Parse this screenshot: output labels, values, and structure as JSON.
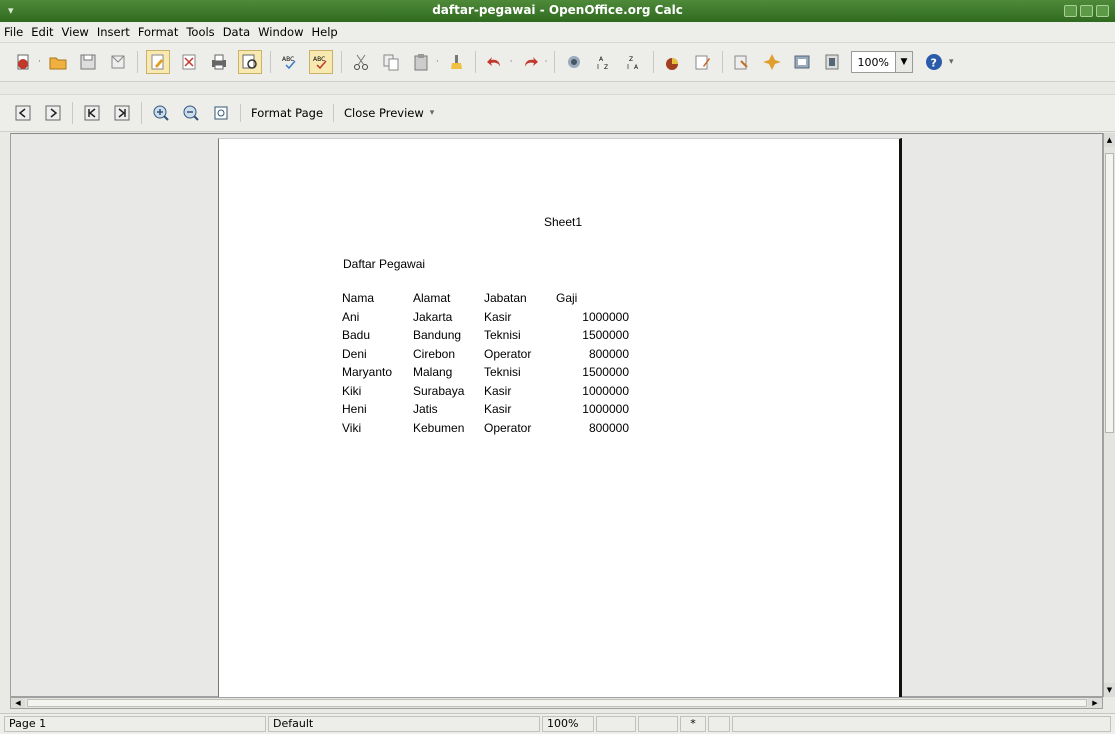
{
  "window": {
    "title": "daftar-pegawai - OpenOffice.org Calc"
  },
  "menu": [
    "File",
    "Edit",
    "View",
    "Insert",
    "Format",
    "Tools",
    "Data",
    "Window",
    "Help"
  ],
  "toolbar": {
    "icons": [
      "new-icon",
      "open-icon",
      "save-icon",
      "email-icon",
      "edit-file-icon",
      "export-pdf-icon",
      "print-icon",
      "page-preview-icon",
      "spellcheck-icon",
      "autospellcheck-icon",
      "cut-icon",
      "copy-icon",
      "paste-icon",
      "clone-format-icon",
      "undo-icon",
      "redo-icon",
      "hyperlink-icon",
      "sort-ascending-icon",
      "sort-descending-icon",
      "chart-icon",
      "draw-functions-icon",
      "navigator-icon",
      "gallery-icon",
      "datasource-icon",
      "help-icon"
    ],
    "zoom_value": "100%"
  },
  "preview_toolbar": {
    "format_page": "Format Page",
    "close_preview": "Close Preview"
  },
  "page": {
    "sheet_name": "Sheet1",
    "title": "Daftar Pegawai",
    "headers": [
      "Nama",
      "Alamat",
      "Jabatan",
      "Gaji"
    ],
    "rows": [
      [
        "Ani",
        "Jakarta",
        "Kasir",
        "1000000"
      ],
      [
        "Badu",
        "Bandung",
        "Teknisi",
        "1500000"
      ],
      [
        "Deni",
        "Cirebon",
        "Operator",
        "800000"
      ],
      [
        "Maryanto",
        "Malang",
        "Teknisi",
        "1500000"
      ],
      [
        "Kiki",
        "Surabaya",
        "Kasir",
        "1000000"
      ],
      [
        "Heni",
        "Jatis",
        "Kasir",
        "1000000"
      ],
      [
        "Viki",
        "Kebumen",
        "Operator",
        "800000"
      ]
    ]
  },
  "status": {
    "page": "Page 1",
    "style": "Default",
    "zoom": "100%",
    "modified": "*"
  }
}
